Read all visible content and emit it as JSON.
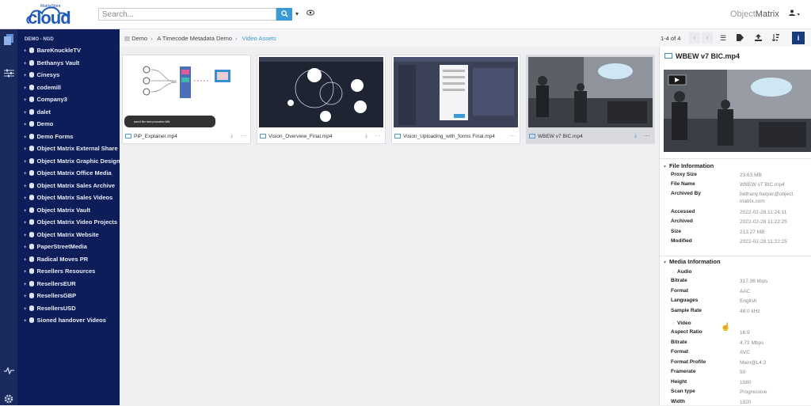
{
  "app": {
    "logo_small": "MatrixStore",
    "logo_big": "cloud",
    "brand_left": "Object",
    "brand_right": "Matrix"
  },
  "search": {
    "placeholder": "Search..."
  },
  "tree": {
    "heading": "DEMO - NGD",
    "items": [
      "BareKnuckleTV",
      "Bethanys Vault",
      "Cinesys",
      "codemill",
      "Company3",
      "dalet",
      "Demo",
      "Demo Forms",
      "Object Matrix External Share",
      "Object Matrix Graphic Design",
      "Object Matrix Office Media",
      "Object Matrix Sales Archive",
      "Object Matrix Sales Videos",
      "Object Matrix Vault",
      "Object Matrix Video Projects",
      "Object Matrix Website",
      "PaperStreetMedia",
      "Radical Moves PR",
      "Resellers Resources",
      "ResellersEUR",
      "ResellersGBP",
      "ResellersUSD",
      "Sioned handover Videos"
    ]
  },
  "breadcrumb": [
    "Demo",
    "A Timecode Metadata Demo",
    "Video Assets"
  ],
  "pager": {
    "label": "1-4 of 4"
  },
  "assets": [
    {
      "name": "PiP_Explainer.mp4",
      "caption": "want it like main production Wiki"
    },
    {
      "name": "Vision_Overview_Final.mp4",
      "caption": ""
    },
    {
      "name": "Vision_Uploading_with_forms Final.mp4",
      "caption": ""
    },
    {
      "name": "WBEW v7 BIC.mp4",
      "caption": ""
    }
  ],
  "panel": {
    "title": "WBEW v7 BIC.mp4",
    "file_info": {
      "heading": "File Information",
      "rows": [
        {
          "k": "Proxy Size",
          "v": "23.63 MB"
        },
        {
          "k": "File Name",
          "v": "WBEW v7 BIC.mp4"
        },
        {
          "k": "Archived By",
          "v": "bethany.harper@objectmatrix.com"
        },
        {
          "k": "Accessed",
          "v": "2022-02-28 11:24:11"
        },
        {
          "k": "Archived",
          "v": "2022-02-28 11:22:25"
        },
        {
          "k": "Size",
          "v": "213.27 MB"
        },
        {
          "k": "Modified",
          "v": "2022-02-28 11:22:25"
        }
      ]
    },
    "media_info": {
      "heading": "Media Information",
      "audio": {
        "label": "Audio",
        "rows": [
          {
            "k": "Bitrate",
            "v": "317.36 kbps"
          },
          {
            "k": "Format",
            "v": "AAC"
          },
          {
            "k": "Languages",
            "v": "English"
          },
          {
            "k": "Sample Rate",
            "v": "48.0 kHz"
          }
        ]
      },
      "video": {
        "label": "Video",
        "rows": [
          {
            "k": "Aspect Ratio",
            "v": "16:9"
          },
          {
            "k": "Bitrate",
            "v": "4.72 Mbps"
          },
          {
            "k": "Format",
            "v": "AVC"
          },
          {
            "k": "Format Profile",
            "v": "Main@L4.2"
          },
          {
            "k": "Framerate",
            "v": "50"
          },
          {
            "k": "Height",
            "v": "1080"
          },
          {
            "k": "Scan type",
            "v": "Progressive"
          },
          {
            "k": "Width",
            "v": "1920"
          }
        ]
      }
    }
  },
  "icons": {
    "search": "search-icon",
    "caret": "chevron-down-icon",
    "eye": "eye-icon",
    "user": "user-icon",
    "library": "library-icon",
    "sliders": "sliders-icon",
    "activity": "activity-icon",
    "settings": "gear-icon",
    "prev": "chevron-left-icon",
    "next": "chevron-right-icon",
    "list": "list-view-icon",
    "tag": "tag-icon",
    "upload": "upload-icon",
    "sort": "sort-icon",
    "info": "info-icon"
  },
  "colors": {
    "sidebar": "#0d1d5a",
    "rail": "#1b2a5c",
    "accent": "#3a9bd8",
    "info_button": "#1a3a7a"
  }
}
